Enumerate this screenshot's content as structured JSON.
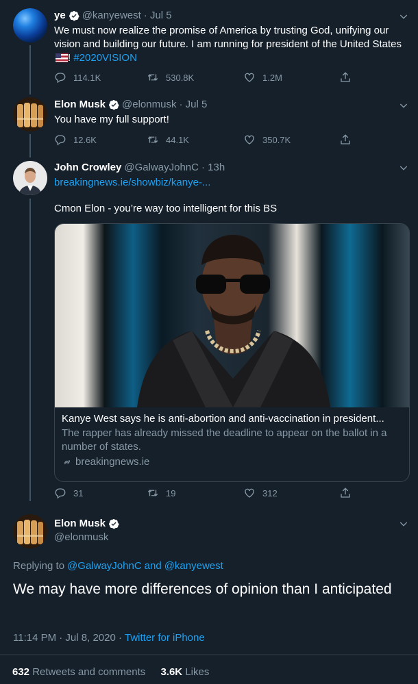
{
  "tweet1": {
    "name": "ye",
    "handle": "@kanyewest",
    "date": "· Jul 5",
    "text_main": "We must now realize the promise of America by trusting God, unifying our vision and building our future. I am running for president of the United States",
    "text_after_flag": "!",
    "hashtag": "#2020VISION",
    "replies": "114.1K",
    "retweets": "530.8K",
    "likes": "1.2M"
  },
  "tweet2": {
    "name": "Elon Musk",
    "handle": "@elonmusk",
    "date": "· Jul 5",
    "text": "You have my full support!",
    "replies": "12.6K",
    "retweets": "44.1K",
    "likes": "350.7K"
  },
  "tweet3": {
    "name": "John Crowley",
    "handle": "@GalwayJohnC",
    "date": "· 13h",
    "link": "breakingnews.ie/showbiz/kanye-...",
    "text": "Cmon Elon - you’re way too intelligent for this BS",
    "card": {
      "title": "Kanye West says he is anti-abortion and anti-vaccination in president...",
      "description": "The rapper has already missed the deadline to appear on the ballot in a number of states.",
      "domain": "breakingnews.ie"
    },
    "replies": "31",
    "retweets": "19",
    "likes": "312"
  },
  "main_tweet": {
    "name": "Elon Musk",
    "handle": "@elonmusk",
    "replying_prefix": "Replying to",
    "reply_to_1": "@GalwayJohnC",
    "reply_and": "and",
    "reply_to_2": "@kanyewest",
    "text": "We may have more differences of opinion than I anticipated",
    "time": "11:14 PM · Jul 8, 2020 ·",
    "source": "Twitter for iPhone",
    "retweets_count": "632",
    "retweets_label": "Retweets and comments",
    "likes_count": "3.6K",
    "likes_label": "Likes"
  },
  "colors": {
    "background": "#15202b",
    "accent": "#1da1f2",
    "secondary_text": "#8899a6",
    "border": "#38444d"
  }
}
